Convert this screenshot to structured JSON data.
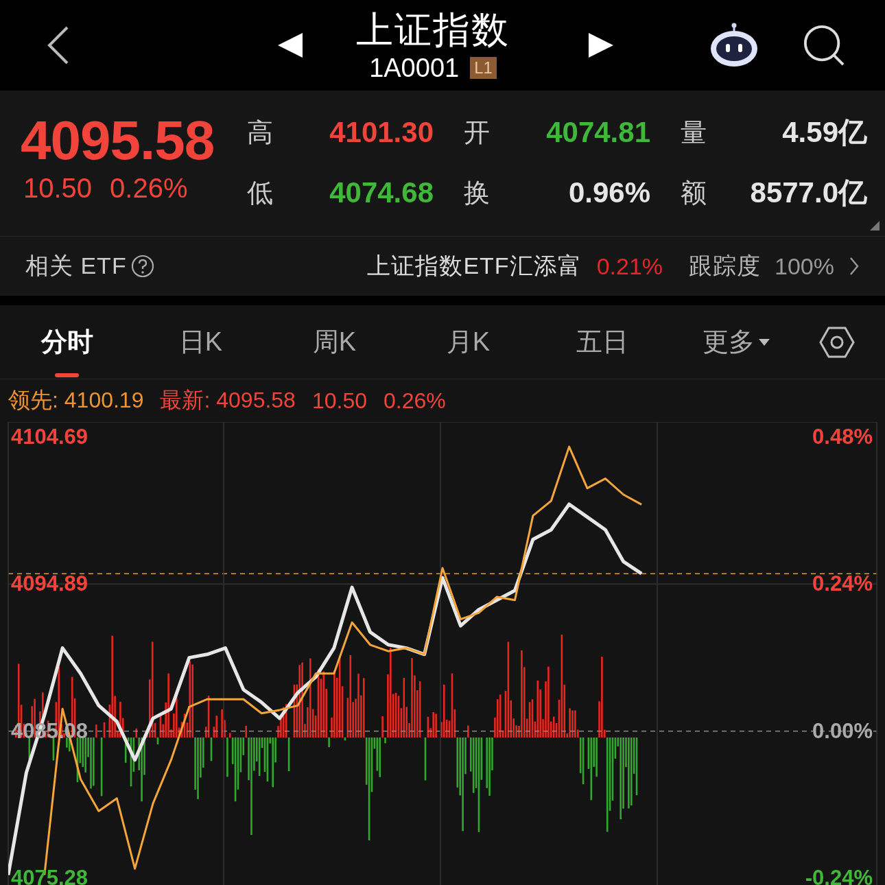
{
  "header": {
    "title": "上证指数",
    "code": "1A0001",
    "level_badge": "L1"
  },
  "quote": {
    "price": "4095.58",
    "change": "10.50",
    "change_pct": "0.26%",
    "color": "#f2443a"
  },
  "stats": [
    {
      "label": "高",
      "value": "4101.30",
      "color": "#f2443a"
    },
    {
      "label": "开",
      "value": "4074.81",
      "color": "#3fb83a"
    },
    {
      "label": "量",
      "value": "4.59亿",
      "color": "#e6e6e6"
    },
    {
      "label": "低",
      "value": "4074.68",
      "color": "#3fb83a"
    },
    {
      "label": "换",
      "value": "0.96%",
      "color": "#e6e6e6"
    },
    {
      "label": "额",
      "value": "8577.0亿",
      "color": "#e6e6e6"
    }
  ],
  "etf": {
    "label": "相关 ETF",
    "name": "上证指数ETF汇添富",
    "change": "0.21%",
    "tracking_label": "跟踪度",
    "tracking": "100%"
  },
  "tabs": [
    {
      "label": "分时",
      "selected": true,
      "kind": "plain"
    },
    {
      "label": "日K",
      "selected": false,
      "kind": "plain"
    },
    {
      "label": "周K",
      "selected": false,
      "kind": "plain"
    },
    {
      "label": "月K",
      "selected": false,
      "kind": "plain"
    },
    {
      "label": "五日",
      "selected": false,
      "kind": "plain"
    },
    {
      "label": "更多",
      "selected": false,
      "kind": "dropdown"
    }
  ],
  "legend": {
    "lead_label": "领先:",
    "lead": "4100.19",
    "latest_label": "最新:",
    "latest": "4095.58",
    "change": "10.50",
    "change_pct": "0.26%"
  },
  "chart": {
    "chart_data": {
      "type": "line",
      "ylim": [
        4074.82,
        4105.7
      ],
      "grid": true,
      "categories": [
        null,
        null,
        null,
        null,
        null,
        null,
        null,
        null,
        null,
        null,
        null,
        null,
        null,
        null,
        null,
        null,
        null,
        null,
        null,
        null,
        null,
        null,
        null,
        null,
        null,
        null,
        null,
        null,
        null,
        null,
        null,
        null,
        null,
        null,
        null,
        null
      ],
      "yticks": [
        {
          "value": 4104.69,
          "label": "4104.69"
        },
        {
          "value": 4094.89,
          "label": "4094.89"
        },
        {
          "value": 4085.08,
          "label": "4085.08"
        },
        {
          "value": 4075.28,
          "label": "4075.28"
        }
      ],
      "series": [
        {
          "color": "#e6e6e6",
          "values": [
            4075.49,
            4082.31,
            4086.15,
            4090.62,
            4088.92,
            4086.79,
            4085.72,
            4083.16,
            4085.93,
            4086.57,
            4089.98,
            4090.2,
            4090.62,
            4087.85,
            4087.0,
            4085.93,
            4087.64,
            4088.7,
            4090.62,
            4094.67,
            4091.69,
            4090.84,
            4090.62,
            4090.2,
            4095.31,
            4092.11,
            4093.18,
            4093.82,
            4094.46,
            4097.87,
            4098.51,
            4100.21,
            4099.36,
            4098.51,
            4096.38,
            4095.58
          ]
        },
        {
          "color": "#f5a53a",
          "values": [
            null,
            null,
            4075.49,
            4086.57,
            4081.88,
            4079.75,
            4080.6,
            4075.91,
            4080.26,
            4083.16,
            4086.7,
            4087.21,
            4087.21,
            4087.21,
            4086.27,
            4086.49,
            4086.79,
            4088.92,
            4088.92,
            4092.33,
            4090.84,
            4090.41,
            4090.62,
            4090.2,
            4095.95,
            4092.54,
            4092.97,
            4094.03,
            4093.82,
            4099.45,
            4100.43,
            4104.05,
            4101.28,
            4101.92,
            4100.85,
            4100.19
          ]
        }
      ]
    },
    "pct_labels": [
      {
        "text": "0.48%",
        "color": "#f2443a"
      },
      {
        "text": "0.24%",
        "color": "#f2443a"
      },
      {
        "text": "0.00%",
        "color": "#aaaaaa"
      },
      {
        "text": "-0.24%",
        "color": "#3fb83a"
      }
    ]
  }
}
